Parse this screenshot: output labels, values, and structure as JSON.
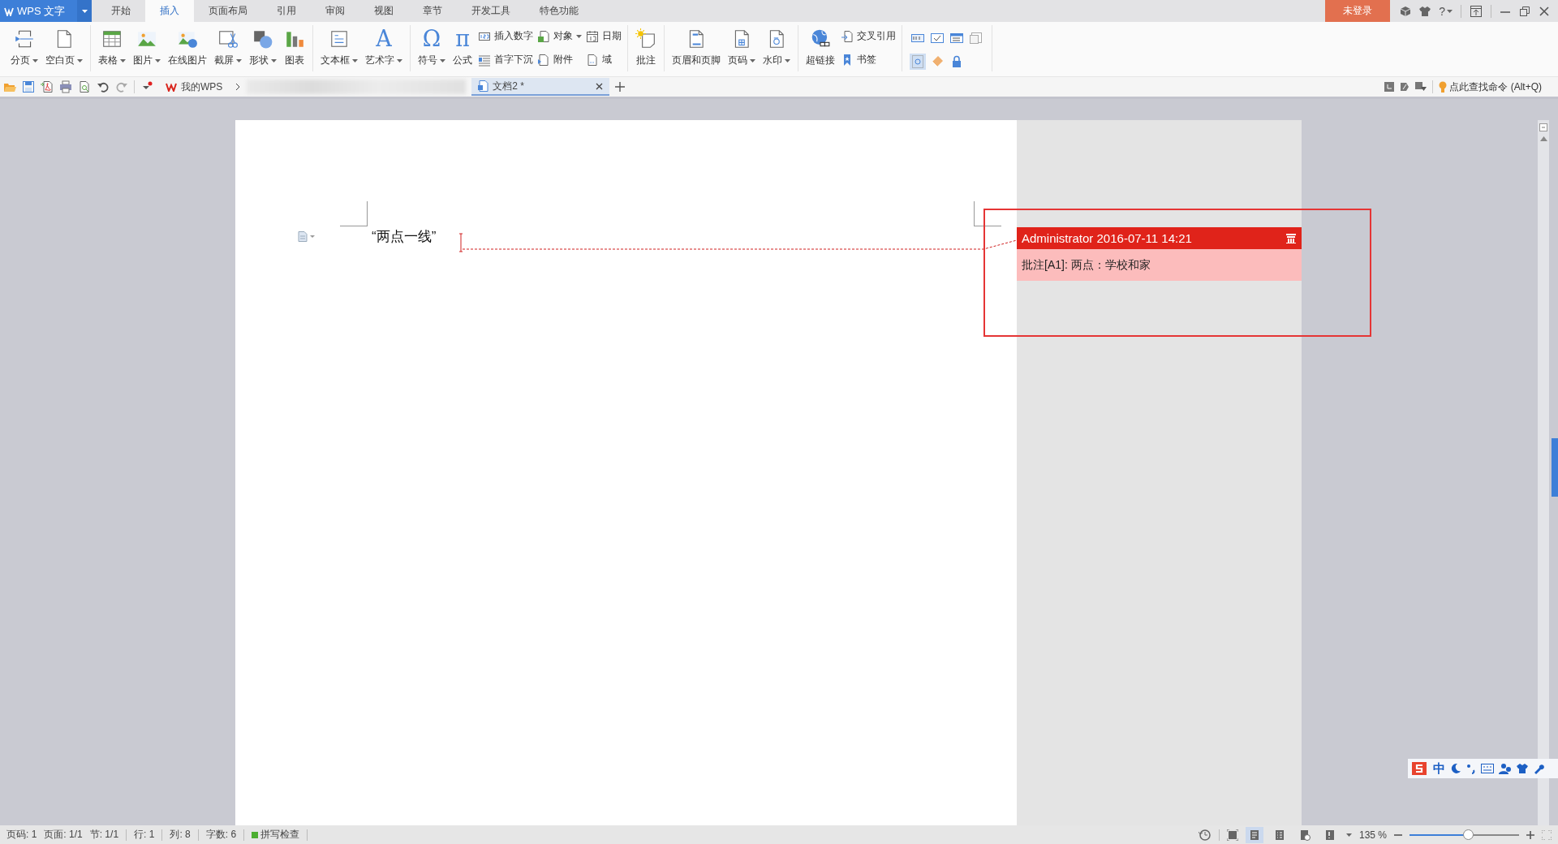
{
  "app": {
    "logo": "WPS 文字"
  },
  "menu_tabs": [
    {
      "label": "开始",
      "selected": false
    },
    {
      "label": "插入",
      "selected": true
    },
    {
      "label": "页面布局",
      "selected": false
    },
    {
      "label": "引用",
      "selected": false
    },
    {
      "label": "审阅",
      "selected": false
    },
    {
      "label": "视图",
      "selected": false
    },
    {
      "label": "章节",
      "selected": false
    },
    {
      "label": "开发工具",
      "selected": false
    },
    {
      "label": "特色功能",
      "selected": false
    }
  ],
  "login_button": "未登录",
  "help": "?",
  "ribbon": [
    {
      "items": [
        {
          "kind": "large",
          "label": "分页",
          "dropdown": true
        },
        {
          "kind": "large",
          "label": "空白页",
          "dropdown": true
        }
      ]
    },
    {
      "items": [
        {
          "kind": "large",
          "label": "表格",
          "dropdown": true
        },
        {
          "kind": "large",
          "label": "图片",
          "dropdown": true
        },
        {
          "kind": "large",
          "label": "在线图片",
          "dropdown": false
        },
        {
          "kind": "large",
          "label": "截屏",
          "dropdown": true
        },
        {
          "kind": "large",
          "label": "形状",
          "dropdown": true
        },
        {
          "kind": "large",
          "label": "图表",
          "dropdown": false
        }
      ]
    },
    {
      "items": [
        {
          "kind": "large",
          "label": "文本框",
          "dropdown": true
        },
        {
          "kind": "large",
          "label": "艺术字",
          "dropdown": true,
          "glyph": "A"
        }
      ]
    },
    {
      "items": [
        {
          "kind": "large",
          "label": "符号",
          "dropdown": true,
          "glyph": "Ω"
        },
        {
          "kind": "large",
          "label": "公式",
          "dropdown": false,
          "glyph": "π"
        },
        {
          "kind": "small",
          "label": "插入数字",
          "dropdown": false
        },
        {
          "kind": "small",
          "label": "首字下沉",
          "dropdown": false
        },
        {
          "kind": "small",
          "label": "对象",
          "dropdown": true
        },
        {
          "kind": "small",
          "label": "附件",
          "dropdown": false
        },
        {
          "kind": "small",
          "label": "日期",
          "dropdown": false
        },
        {
          "kind": "small",
          "label": "域",
          "dropdown": false
        }
      ]
    },
    {
      "items": [
        {
          "kind": "large",
          "label": "批注",
          "dropdown": false
        }
      ]
    },
    {
      "items": [
        {
          "kind": "large",
          "label": "页眉和页脚",
          "dropdown": false
        },
        {
          "kind": "large",
          "label": "页码",
          "dropdown": true
        },
        {
          "kind": "large",
          "label": "水印",
          "dropdown": true
        }
      ]
    },
    {
      "items": [
        {
          "kind": "large",
          "label": "超链接",
          "dropdown": false
        },
        {
          "kind": "small",
          "label": "交叉引用",
          "dropdown": false
        },
        {
          "kind": "small",
          "label": "书签",
          "dropdown": false
        }
      ]
    },
    {
      "items": [
        {
          "kind": "icon",
          "selected": false
        },
        {
          "kind": "icon",
          "selected": false
        },
        {
          "kind": "icon",
          "selected": false
        },
        {
          "kind": "icon",
          "selected": false
        },
        {
          "kind": "icon",
          "selected": true
        },
        {
          "kind": "icon",
          "selected": false
        },
        {
          "kind": "icon",
          "selected": false
        }
      ]
    }
  ],
  "doc_tabs": [
    {
      "label": "我的WPS",
      "selected": false
    },
    {
      "label": "文档2 *",
      "selected": true
    }
  ],
  "command_search": "点此查找命令 (Alt+Q)",
  "document": {
    "paragraph": "“两点一线”"
  },
  "comment": {
    "author": "Administrator",
    "date": "2016-07-11 14:21",
    "text": "批注[A1]: 两点：学校和家"
  },
  "ime_bar": {
    "mode": "中"
  },
  "status_bar": {
    "items": [
      "页码: 1",
      "页面: 1/1",
      "节: 1/1",
      "行: 1",
      "列: 8",
      "字数: 6"
    ],
    "spell_check": "拼写检查",
    "view_buttons": [
      {
        "selected": true
      },
      {
        "selected": false
      },
      {
        "selected": false
      },
      {
        "selected": false
      }
    ],
    "zoom": "135 %",
    "zoom_slider": {
      "level": 0.54
    }
  }
}
